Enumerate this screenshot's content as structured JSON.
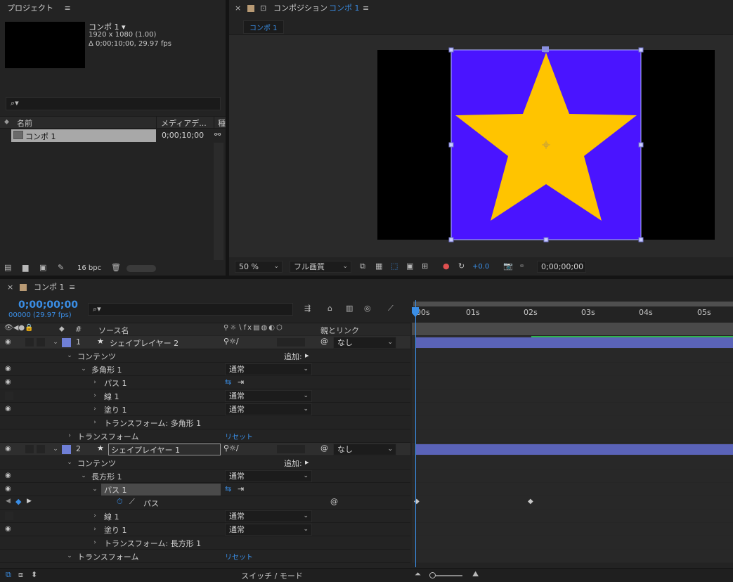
{
  "project": {
    "title": "プロジェクト",
    "comp_name": "コンポ 1 ▾",
    "comp_size": "1920 x 1080 (1.00)",
    "comp_duration": "Δ 0;00;10;00, 29.97 fps",
    "search_placeholder": "",
    "col_name": "名前",
    "col_media": "メディアデ...",
    "col_type": "種",
    "item_name": "コンポ 1",
    "item_duration": "0;00;10;00",
    "bpc": "16 bpc"
  },
  "viewer": {
    "tab_title": "コンポジション",
    "tab_comp": "コンポ 1",
    "breadcrumb": "コンポ 1",
    "zoom": "50 %",
    "quality": "フル画質",
    "exposure": "+0.0",
    "timecode": "0;00;00;00",
    "bg_color": "#000000",
    "shape_rect_color": "#4a14ff",
    "shape_star_color": "#ffc400"
  },
  "timeline": {
    "tab": "コンポ 1",
    "timecode": "0;00;00;00",
    "fps": "00000 (29.97 fps)",
    "col_source": "ソース名",
    "col_hash": "#",
    "col_parent": "親とリンク",
    "ruler": [
      "00s",
      "01s",
      "02s",
      "03s",
      "04s",
      "05s"
    ],
    "bottom_label": "スイッチ / モード",
    "rows": [
      {
        "label": "シェイプレイヤー 2",
        "num": "1",
        "parent": "なし"
      },
      {
        "label": "コンテンツ",
        "add": "追加:"
      },
      {
        "label": "多角形 1",
        "mode": "通常"
      },
      {
        "label": "パス 1"
      },
      {
        "label": "線 1",
        "mode": "通常"
      },
      {
        "label": "塗り 1",
        "mode": "通常"
      },
      {
        "label": "トランスフォーム: 多角形 1"
      },
      {
        "label": "トランスフォーム",
        "reset": "リセット"
      },
      {
        "label": "シェイプレイヤー 1",
        "num": "2",
        "parent": "なし"
      },
      {
        "label": "コンテンツ",
        "add": "追加:"
      },
      {
        "label": "長方形 1",
        "mode": "通常"
      },
      {
        "label": "パス 1"
      },
      {
        "label": "パス"
      },
      {
        "label": "線 1",
        "mode": "通常"
      },
      {
        "label": "塗り 1",
        "mode": "通常"
      },
      {
        "label": "トランスフォーム: 長方形 1"
      },
      {
        "label": "トランスフォーム",
        "reset": "リセット"
      }
    ]
  },
  "colors": {
    "accent_blue": "#3a8ee6",
    "label_color": "#6f7fd6",
    "layer_bar": "#5a63b8",
    "green_bar": "#2fb44a"
  }
}
